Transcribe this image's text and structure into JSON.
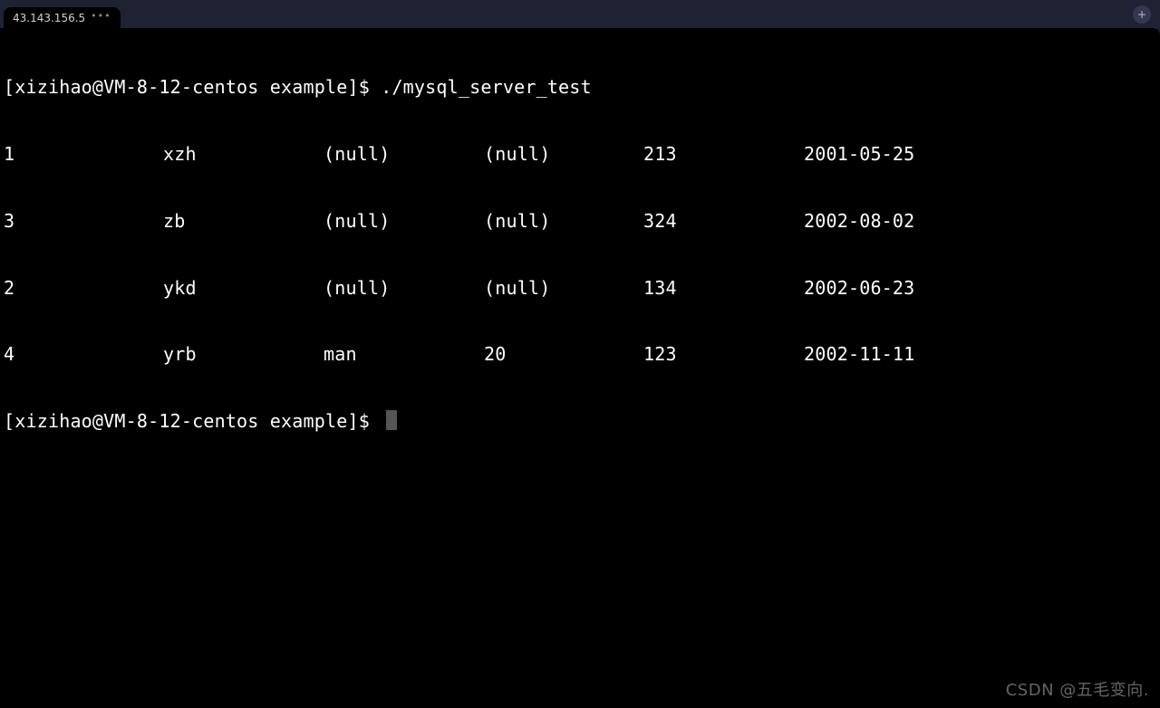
{
  "titlebar": {
    "tab_label": "43.143.156.5",
    "tab_menu": "•••",
    "new_tab_glyph": "+"
  },
  "terminal": {
    "prompt": "[xizihao@VM-8-12-centos example]$ ",
    "command": "./mysql_server_test",
    "rows": [
      {
        "id": "1",
        "name": "xzh",
        "col3": "(null)",
        "col4": "(null)",
        "col5": "213",
        "col6": "2001-05-25"
      },
      {
        "id": "3",
        "name": "zb",
        "col3": "(null)",
        "col4": "(null)",
        "col5": "324",
        "col6": "2002-08-02"
      },
      {
        "id": "2",
        "name": "ykd",
        "col3": "(null)",
        "col4": "(null)",
        "col5": "134",
        "col6": "2002-06-23"
      },
      {
        "id": "4",
        "name": "yrb",
        "col3": "man",
        "col4": "20",
        "col5": "123",
        "col6": "2002-11-11"
      }
    ],
    "prompt2": "[xizihao@VM-8-12-centos example]$ "
  },
  "watermark": "CSDN @五毛变向."
}
